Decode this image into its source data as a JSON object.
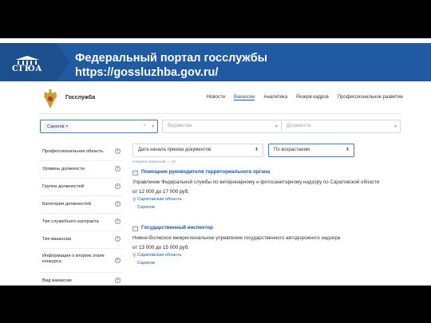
{
  "slide": {
    "logo_text": "СГЮА",
    "title_line1": "Федеральный портал госслужбы",
    "title_line2": "https://gossluzhba.gov.ru/"
  },
  "site": {
    "brand": "Госслужба",
    "nav": [
      "Новости",
      "Вакансии",
      "Аналитика",
      "Резерв кадров",
      "Профессиональное развитие"
    ],
    "active_nav": "Вакансии"
  },
  "filters": {
    "region_chip": "Саратов",
    "region_chip_close": "×",
    "clear": "×",
    "dropdown": "▾",
    "department_placeholder": "Ведомства",
    "position_placeholder": "Должности"
  },
  "sidebar": {
    "items": [
      "Профессиональная область",
      "Уровень должности",
      "Группа должностей",
      "Категория должностей",
      "Тип служебного контракта",
      "Тип вакансии",
      "Информация о втором этапе конкурса",
      "Вид вакансии"
    ],
    "plus": "+"
  },
  "sort": {
    "date_label": "Дата начала приема документов",
    "order_label": "По возрастанию",
    "arrow": "⬍"
  },
  "results": {
    "found_text": "Найдено вакансий — 22",
    "pin": "⚲",
    "items": [
      {
        "title": "Помощник руководителя территориального органа",
        "org": "Управление Федеральной службы по ветеринарному и фитосанитарному надзору по Саратовской области",
        "salary": "от 12 000  до 17 000  руб.",
        "region": "Саратовская область",
        "city": "Саратов"
      },
      {
        "title": "Государственный инспектор",
        "org": "Нижне-Волжское межрегиональное управление государственного автодорожного надзора",
        "salary": "от 13 000  до 15 000  руб.",
        "region": "Саратовская область",
        "city": "Саратов"
      }
    ]
  },
  "colors": {
    "banner": "#1f5aa3",
    "link": "#1f5aa3"
  }
}
